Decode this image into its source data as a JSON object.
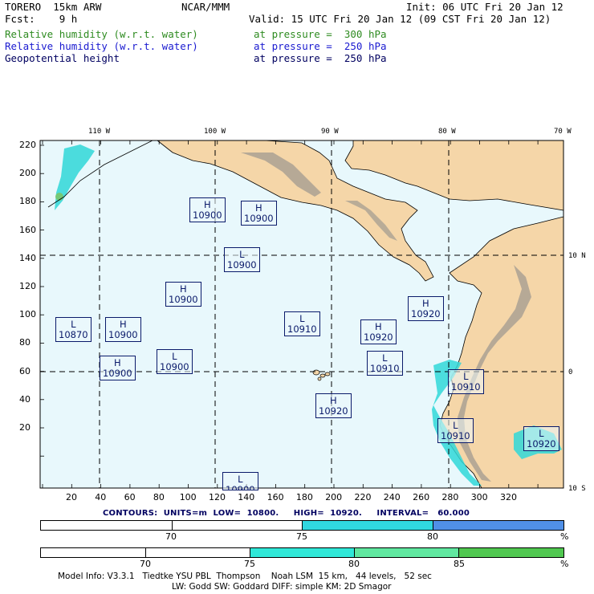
{
  "header": {
    "model": "TORERO  15km ARW",
    "org": "NCAR/MMM",
    "init": "Init: 06 UTC Fri 20 Jan 12",
    "fcst": "Fcst:    9 h",
    "valid": "Valid: 15 UTC Fri 20 Jan 12 (09 CST Fri 20 Jan 12)"
  },
  "fields": [
    {
      "name": "Relative humidity (w.r.t. water)",
      "level": "at pressure =  300 hPa",
      "color": "#2e8b20"
    },
    {
      "name": "Relative humidity (w.r.t. water)",
      "level": "at pressure =  250 hPa",
      "color": "#1a1ad0"
    },
    {
      "name": "Geopotential height",
      "level": "at pressure =  250 hPa",
      "color": "#000060"
    }
  ],
  "map": {
    "top_labels": [
      "110 W",
      "100 W",
      "90 W",
      "80 W",
      "70 W"
    ],
    "right_labels": [
      "10 N",
      "0",
      "10 S"
    ],
    "left_ticks": [
      "220",
      "200",
      "180",
      "160",
      "140",
      "120",
      "100",
      "80",
      "60",
      "40",
      "20"
    ],
    "bottom_ticks": [
      "20",
      "40",
      "60",
      "80",
      "100",
      "120",
      "140",
      "160",
      "180",
      "200",
      "220",
      "240",
      "260",
      "280",
      "300",
      "320"
    ],
    "centers": [
      {
        "type": "H",
        "value": "10900"
      },
      {
        "type": "H",
        "value": "10900"
      },
      {
        "type": "L",
        "value": "10900"
      },
      {
        "type": "H",
        "value": "10900"
      },
      {
        "type": "L",
        "value": "10870"
      },
      {
        "type": "H",
        "value": "10900"
      },
      {
        "type": "H",
        "value": "10900"
      },
      {
        "type": "L",
        "value": "10900"
      },
      {
        "type": "L",
        "value": "10910"
      },
      {
        "type": "H",
        "value": "10920"
      },
      {
        "type": "H",
        "value": "10920"
      },
      {
        "type": "L",
        "value": "10910"
      },
      {
        "type": "L",
        "value": "10910"
      },
      {
        "type": "H",
        "value": "10920"
      },
      {
        "type": "L",
        "value": "10910"
      },
      {
        "type": "L",
        "value": "10920"
      },
      {
        "type": "L",
        "value": "10900"
      }
    ],
    "colors": {
      "ocean": "#e8f8fc",
      "land": "#f5d6a8",
      "mountain": "#a09a90",
      "humidity": "#30d8d8"
    }
  },
  "contours": "CONTOURS:  UNITS=m  LOW=  10800.     HIGH=  10920.     INTERVAL=   60.000",
  "colorbar_top": {
    "labels": [
      "70",
      "75",
      "80",
      "%"
    ],
    "colors": [
      "#ffffff",
      "#ffffff",
      "#30d8e0",
      "#5090e8"
    ]
  },
  "colorbar_bottom": {
    "labels": [
      "70",
      "75",
      "80",
      "85",
      "%"
    ],
    "colors": [
      "#ffffff",
      "#ffffff",
      "#30e8d8",
      "#60e8a0",
      "#50c850"
    ]
  },
  "footer": {
    "line1": "Model Info: V3.3.1   Tiedtke YSU PBL  Thompson    Noah LSM  15 km,   44 levels,   52 sec",
    "line2": "LW: Godd SW: Goddard DIFF: simple KM: 2D Smagor"
  }
}
